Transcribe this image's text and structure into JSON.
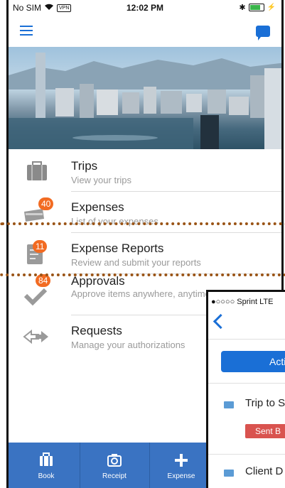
{
  "statusbar": {
    "carrier": "No SIM",
    "vpn": "VPN",
    "time": "12:02 PM"
  },
  "header": {
    "menu_icon": "hamburger-icon",
    "chat_icon": "chat-icon"
  },
  "menu": {
    "items": [
      {
        "title": "Trips",
        "subtitle": "View your trips",
        "icon": "briefcase-icon",
        "badge": ""
      },
      {
        "title": "Expenses",
        "subtitle": "List of your expenses",
        "icon": "card-icon",
        "badge": "40"
      },
      {
        "title": "Expense Reports",
        "subtitle": "Review and submit your reports",
        "icon": "report-icon",
        "badge": "11"
      },
      {
        "title": "Approvals",
        "subtitle": "Approve items anywhere, anytime",
        "icon": "checkmark-icon",
        "badge": "84"
      },
      {
        "title": "Requests",
        "subtitle": "Manage your authorizations",
        "icon": "arrows-icon",
        "badge": ""
      }
    ]
  },
  "tabbar": {
    "tabs": [
      {
        "label": "Book",
        "icon": "briefcase-icon"
      },
      {
        "label": "Receipt",
        "icon": "camera-icon"
      },
      {
        "label": "Expense",
        "icon": "plus-icon"
      }
    ]
  },
  "overlay": {
    "status": "●○○○○ Sprint  LTE",
    "button_label": "Acti",
    "rows": [
      {
        "title": "Trip to S",
        "tag": "Sent B"
      },
      {
        "title": "Client D"
      }
    ]
  },
  "colors": {
    "accent": "#1a6fd6",
    "tabbar": "#3a73c2",
    "badge": "#f26b22",
    "highlight": "#9a5416"
  }
}
